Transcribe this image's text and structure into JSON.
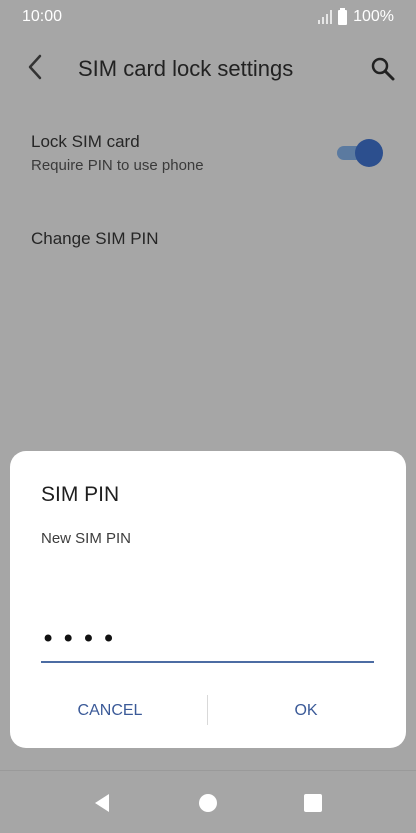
{
  "status_bar": {
    "time": "10:00",
    "battery": "100%"
  },
  "app_bar": {
    "title": "SIM card lock settings"
  },
  "settings": {
    "lock_sim": {
      "title": "Lock SIM card",
      "subtitle": "Require PIN to use phone",
      "enabled": true
    },
    "change_pin": {
      "title": "Change SIM PIN"
    }
  },
  "dialog": {
    "title": "SIM PIN",
    "message": "New SIM PIN",
    "pin_value": "••••",
    "cancel_label": "CANCEL",
    "ok_label": "OK"
  },
  "icons": {
    "back": "back-arrow-icon",
    "search": "search-icon",
    "nav_back": "triangle-back-icon",
    "nav_home": "circle-home-icon",
    "nav_recent": "square-recent-icon"
  },
  "colors": {
    "scrim_background": "#a6a6a6",
    "accent": "#3b5a98",
    "toggle_thumb": "#2c4f8e",
    "dialog_background": "#ffffff"
  }
}
